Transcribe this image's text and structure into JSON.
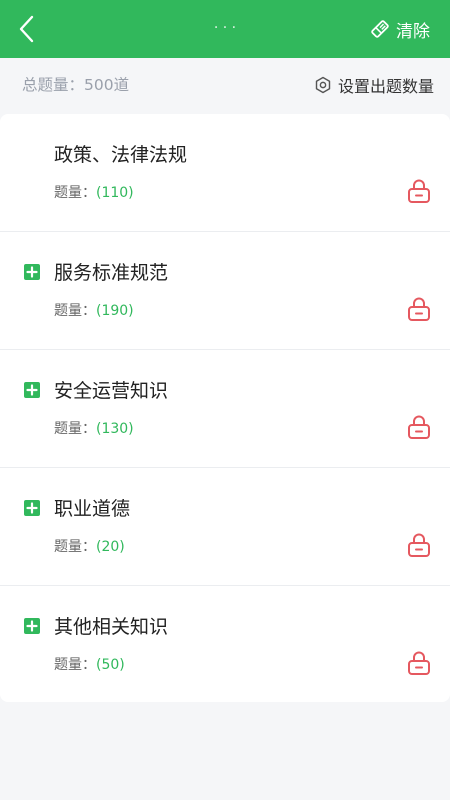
{
  "header": {
    "title": "· · ·",
    "clear_label": "清除"
  },
  "info": {
    "total_text": "总题量：500道",
    "settings_label": "设置出题数量"
  },
  "categories": [
    {
      "name": "政策、法律法规",
      "count_label": "题量：",
      "count": "(110)",
      "has_plus": false
    },
    {
      "name": "服务标准规范",
      "count_label": "题量：",
      "count": "(190)",
      "has_plus": true
    },
    {
      "name": "安全运营知识",
      "count_label": "题量：",
      "count": "(130)",
      "has_plus": true
    },
    {
      "name": "职业道德",
      "count_label": "题量：",
      "count": "(20)",
      "has_plus": true
    },
    {
      "name": "其他相关知识",
      "count_label": "题量：",
      "count": "(50)",
      "has_plus": true
    }
  ],
  "colors": {
    "brand_green": "#31b85c",
    "lock_red": "#e5585f",
    "background": "#f5f6f8"
  },
  "icons": {
    "back": "chevron-left-icon",
    "clear": "eraser-icon",
    "settings": "gear-icon",
    "expand": "plus-square-icon",
    "lock": "lock-icon"
  }
}
